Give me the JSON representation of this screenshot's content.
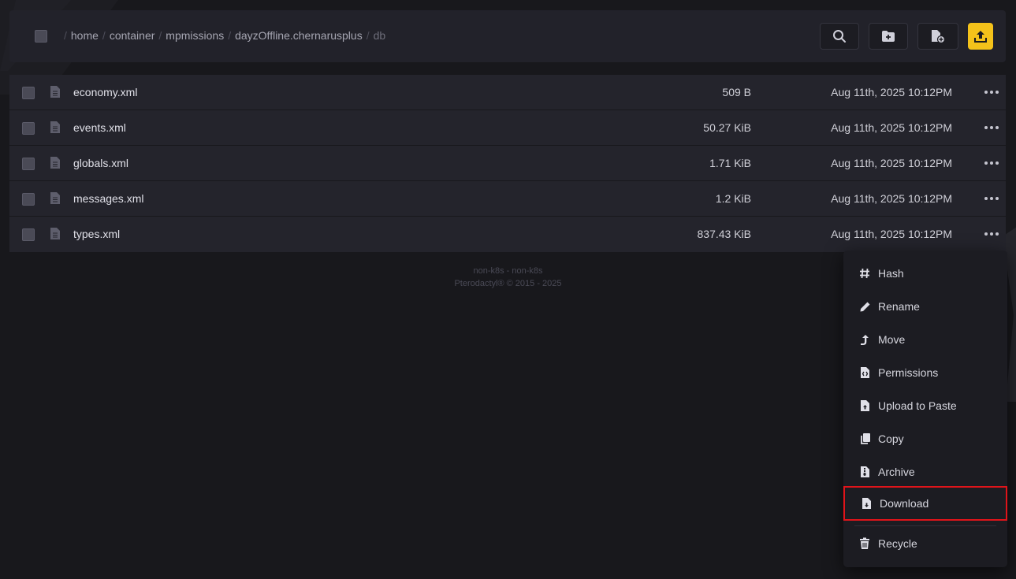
{
  "breadcrumb": {
    "root_sep": "/",
    "items": [
      {
        "label": "home",
        "current": false
      },
      {
        "label": "container",
        "current": false
      },
      {
        "label": "mpmissions",
        "current": false
      },
      {
        "label": "dayzOffline.chernarusplus",
        "current": false
      },
      {
        "label": "db",
        "current": true
      }
    ]
  },
  "toolbar": {
    "search_icon": "search-icon",
    "new_folder_icon": "folder-plus-icon",
    "new_file_icon": "file-plus-icon",
    "upload_icon": "upload-icon",
    "upload_color": "#f4c21a"
  },
  "files": [
    {
      "name": "economy.xml",
      "size": "509 B",
      "modified": "Aug 11th, 2025 10:12PM"
    },
    {
      "name": "events.xml",
      "size": "50.27 KiB",
      "modified": "Aug 11th, 2025 10:12PM"
    },
    {
      "name": "globals.xml",
      "size": "1.71 KiB",
      "modified": "Aug 11th, 2025 10:12PM"
    },
    {
      "name": "messages.xml",
      "size": "1.2 KiB",
      "modified": "Aug 11th, 2025 10:12PM"
    },
    {
      "name": "types.xml",
      "size": "837.43 KiB",
      "modified": "Aug 11th, 2025 10:12PM"
    }
  ],
  "footer": {
    "line1": "non-k8s - non-k8s",
    "line2": "Pterodactyl® © 2015 - 2025"
  },
  "context_menu": {
    "items": [
      {
        "label": "Hash",
        "icon": "hash-icon"
      },
      {
        "label": "Rename",
        "icon": "pencil-icon"
      },
      {
        "label": "Move",
        "icon": "move-arrow-icon"
      },
      {
        "label": "Permissions",
        "icon": "file-code-icon"
      },
      {
        "label": "Upload to Paste",
        "icon": "file-upload-icon"
      },
      {
        "label": "Copy",
        "icon": "copy-icon"
      },
      {
        "label": "Archive",
        "icon": "file-archive-icon"
      },
      {
        "label": "Download",
        "icon": "file-download-icon",
        "highlighted": true
      },
      {
        "label": "Recycle",
        "icon": "trash-icon"
      }
    ],
    "highlight_color": "#e0141a"
  }
}
